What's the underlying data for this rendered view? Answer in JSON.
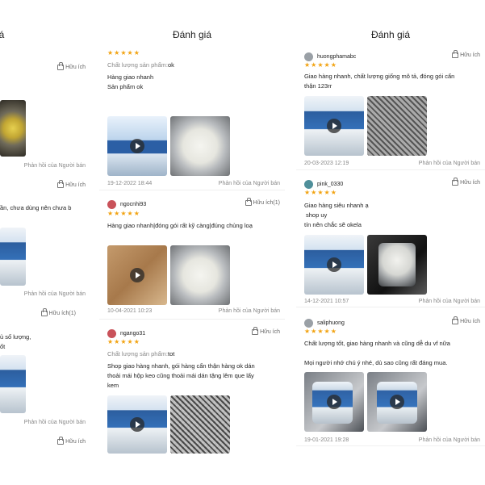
{
  "panels": {
    "left": {
      "header": "iá",
      "helpful_1": "Hữu ích",
      "reply_1": "Phản hồi của Người bán",
      "helpful_2": "Hữu ích",
      "text_2": "ần, chưa dùng nên chưa b",
      "reply_2": "Phản hồi của Người bán",
      "helpful_3": "Hữu ích(1)",
      "text_3a": "ủ số lượng,",
      "text_3b": "ốt",
      "reply_3": "Phản hồi của Người bán",
      "helpful_4": "Hữu ích"
    },
    "middle": {
      "header": "Đánh giá",
      "reviews": [
        {
          "stars": "★★★★★",
          "quality_label": "Chất lượng sản phẩm:",
          "quality_value": "ok",
          "line1": "Hàng giao nhanh",
          "line2": "Sản phẩm ok",
          "date": "19-12-2022 18:44",
          "reply": "Phản hồi của Người bán"
        },
        {
          "user": "ngocnhi93",
          "helpful": "Hữu ích(1)",
          "stars": "★★★★★",
          "line1": "Hàng giao nhanh|đóng gói rất kỹ càng|đúng chủng loạ",
          "date": "10-04-2021 10:23",
          "reply": "Phản hồi của Người bán"
        },
        {
          "user": "ngango31",
          "helpful": "Hữu ích",
          "stars": "★★★★★",
          "quality_label": "Chất lượng sản phẩm:",
          "quality_value": "tot",
          "line1": "Shop giao hàng nhanh, gói hàng cẩn thận hàng ok dán",
          "line2": "thoải mái hộp keo cũng thoải mái dán tặng lêm que lấy",
          "line3": "kem"
        }
      ]
    },
    "right": {
      "header": "Đánh giá",
      "reviews": [
        {
          "user": "huongphamabc",
          "helpful": "Hữu ích",
          "stars": "★★★★★",
          "line1": "Giao hàng nhanh, chất lượng giống mô tả, đóng gói cẩn",
          "line2": "thận 123rr",
          "date": "20-03-2023 12:19",
          "reply": "Phản hồi của Người bán"
        },
        {
          "user": "pink_0330",
          "helpful": "Hữu ích",
          "stars": "★★★★★",
          "line1": "Giao hàng siêu nhanh ạ",
          "line2": "shop uy",
          "line3": "tín nên chắc sẽ okela",
          "date": "14-12-2021 10:57",
          "reply": "Phản hồi của Người bán"
        },
        {
          "user": "saliphuong",
          "helpful": "Hữu ích",
          "stars": "★★★★★",
          "line1": "Chất lượng tốt, giao hàng nhanh và cũng dễ du vf nữa",
          "line2": "Mọi người nhớ chú ý nhé, dù sao cũng rất đáng mua.",
          "date": "19-01-2021 19:28",
          "reply": "Phản hồi của Người bán"
        }
      ]
    }
  },
  "colors": {
    "star": "#f2a311",
    "text": "#222222",
    "muted": "#888888"
  },
  "icons": [
    "thumbs-up-icon",
    "play-icon",
    "avatar-icon",
    "star-icon"
  ]
}
